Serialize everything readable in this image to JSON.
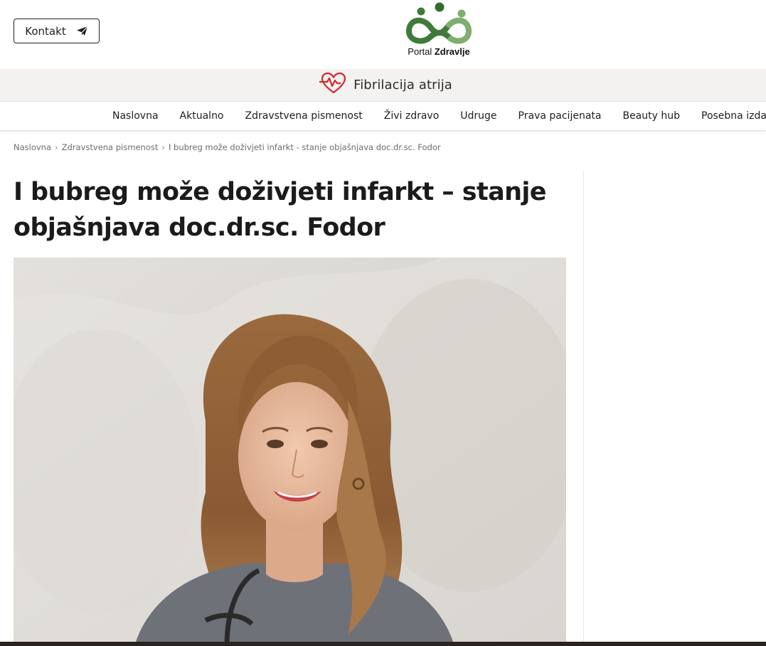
{
  "header": {
    "contact_label": "Kontakt",
    "logo_text_light": "Portal ",
    "logo_text_bold": "Zdravlje",
    "brand_color": "#3f7a3a"
  },
  "promo": {
    "label": "Fibrilacija atrija",
    "icon": "heart-pulse-icon",
    "icon_color": "#d6262e"
  },
  "nav": {
    "items": [
      "Naslovna",
      "Aktualno",
      "Zdravstvena pismenost",
      "Živi zdravo",
      "Udruge",
      "Prava pacijenata",
      "Beauty hub",
      "Posebna izdanja"
    ]
  },
  "breadcrumb": {
    "items": [
      "Naslovna",
      "Zdravstvena pismenost",
      "I bubreg može doživjeti infarkt - stanje objašnjava doc.dr.sc. Fodor"
    ]
  },
  "article": {
    "title_line1": "I bubreg može doživjeti infarkt – stanje",
    "title_line2": "objašnjava doc.dr.sc. Fodor"
  }
}
